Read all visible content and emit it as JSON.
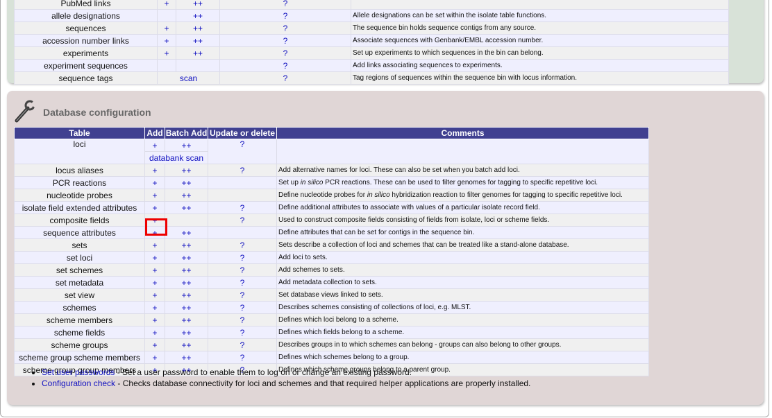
{
  "top_table": {
    "rows": [
      {
        "name": "PubMed links",
        "add": "+",
        "batch": "++",
        "update": "?",
        "comment": []
      },
      {
        "name": "allele designations",
        "add": "",
        "batch": "++",
        "update": "?",
        "comment": [
          {
            "text": "Allele designations can be set within the isolate table functions."
          }
        ]
      },
      {
        "name": "sequences",
        "add": "+",
        "batch": "++",
        "update": "?",
        "comment": [
          {
            "text": "The sequence bin holds sequence contigs from any source."
          }
        ]
      },
      {
        "name": "accession number links",
        "add": "+",
        "batch": "++",
        "update": "?",
        "comment": [
          {
            "text": "Associate sequences with Genbank/EMBL accession number."
          }
        ]
      },
      {
        "name": "experiments",
        "add": "+",
        "batch": "++",
        "update": "?",
        "comment": [
          {
            "text": "Set up experiments to which sequences in the bin can belong."
          }
        ]
      },
      {
        "name": "experiment sequences",
        "add": "",
        "batch": "",
        "update": "?",
        "comment": [
          {
            "text": "Add links associating sequences to experiments."
          }
        ]
      },
      {
        "name": "sequence tags",
        "merged": "scan",
        "update": "?",
        "comment": [
          {
            "text": "Tag regions of sequences within the sequence bin with locus information."
          }
        ]
      }
    ]
  },
  "config": {
    "title": "Database configuration",
    "icon": "wrench-icon",
    "headers": [
      "Table",
      "Add",
      "Batch Add",
      "Update or delete",
      "Comments"
    ],
    "loci": {
      "name": "loci",
      "add": "+",
      "batch": "++",
      "update": "?",
      "extra": "databank scan"
    },
    "rows": [
      {
        "name": "locus aliases",
        "add": "+",
        "batch": "++",
        "update": "?",
        "comment": [
          {
            "text": "Add alternative names for loci. These can also be set when you batch add loci."
          }
        ]
      },
      {
        "name": "PCR reactions",
        "add": "+",
        "batch": "++",
        "update": "",
        "comment": [
          {
            "text": "Set up "
          },
          {
            "text": "in silico",
            "italic": true
          },
          {
            "text": " PCR reactions. These can be used to filter genomes for tagging to specific repetitive loci."
          }
        ]
      },
      {
        "name": "nucleotide probes",
        "add": "+",
        "batch": "++",
        "update": "",
        "comment": [
          {
            "text": "Define nucleotide probes for "
          },
          {
            "text": "in silico",
            "italic": true
          },
          {
            "text": " hybridization reaction to filter genomes for tagging to specific repetitive loci."
          }
        ]
      },
      {
        "name": "isolate field extended attributes",
        "add": "+",
        "batch": "++",
        "update": "?",
        "comment": [
          {
            "text": "Define additional attributes to associate with values of a particular isolate record field."
          }
        ]
      },
      {
        "name": "composite fields",
        "add": "+",
        "batch": "",
        "update": "?",
        "comment": [
          {
            "text": "Used to construct composite fields consisting of fields from isolate, loci or scheme fields."
          }
        ]
      },
      {
        "name": "sequence attributes",
        "add": "+",
        "batch": "++",
        "update": "",
        "comment": [
          {
            "text": "Define attributes that can be set for contigs in the sequence bin."
          }
        ],
        "highlighted": true
      },
      {
        "name": "sets",
        "add": "+",
        "batch": "++",
        "update": "?",
        "comment": [
          {
            "text": "Sets describe a collection of loci and schemes that can be treated like a stand-alone database."
          }
        ]
      },
      {
        "name": "set loci",
        "add": "+",
        "batch": "++",
        "update": "?",
        "comment": [
          {
            "text": "Add loci to sets."
          }
        ]
      },
      {
        "name": "set schemes",
        "add": "+",
        "batch": "++",
        "update": "?",
        "comment": [
          {
            "text": "Add schemes to sets."
          }
        ]
      },
      {
        "name": "set metadata",
        "add": "+",
        "batch": "++",
        "update": "?",
        "comment": [
          {
            "text": "Add metadata collection to sets."
          }
        ]
      },
      {
        "name": "set view",
        "add": "+",
        "batch": "++",
        "update": "?",
        "comment": [
          {
            "text": "Set database views linked to sets."
          }
        ]
      },
      {
        "name": "schemes",
        "add": "+",
        "batch": "++",
        "update": "?",
        "comment": [
          {
            "text": "Describes schemes consisting of collections of loci, e.g. MLST."
          }
        ]
      },
      {
        "name": "scheme members",
        "add": "+",
        "batch": "++",
        "update": "?",
        "comment": [
          {
            "text": "Defines which loci belong to a scheme."
          }
        ]
      },
      {
        "name": "scheme fields",
        "add": "+",
        "batch": "++",
        "update": "?",
        "comment": [
          {
            "text": "Defines which fields belong to a scheme."
          }
        ]
      },
      {
        "name": "scheme groups",
        "add": "+",
        "batch": "++",
        "update": "?",
        "comment": [
          {
            "text": "Describes groups in to which schemes can belong - groups can also belong to other groups."
          }
        ]
      },
      {
        "name": "scheme group scheme members",
        "add": "+",
        "batch": "++",
        "update": "?",
        "comment": [
          {
            "text": "Defines which schemes belong to a group."
          }
        ]
      },
      {
        "name": "scheme group group members",
        "add": "+",
        "batch": "++",
        "update": "?",
        "comment": [
          {
            "text": "Defines which scheme groups belong to a parent group."
          }
        ]
      }
    ],
    "links": [
      {
        "label": "Set user passwords",
        "desc": " - Set a user password to enable them to log on or change an existing password."
      },
      {
        "label": "Configuration check",
        "desc": " - Checks database connectivity for loci and schemes and that required helper applications are properly installed."
      }
    ]
  },
  "colors": {
    "header_bg": "#404090",
    "link": "#1010c0",
    "highlight": "#ee0000",
    "green_panel": "#d8e2d8",
    "config_panel": "#e0d6d6"
  }
}
